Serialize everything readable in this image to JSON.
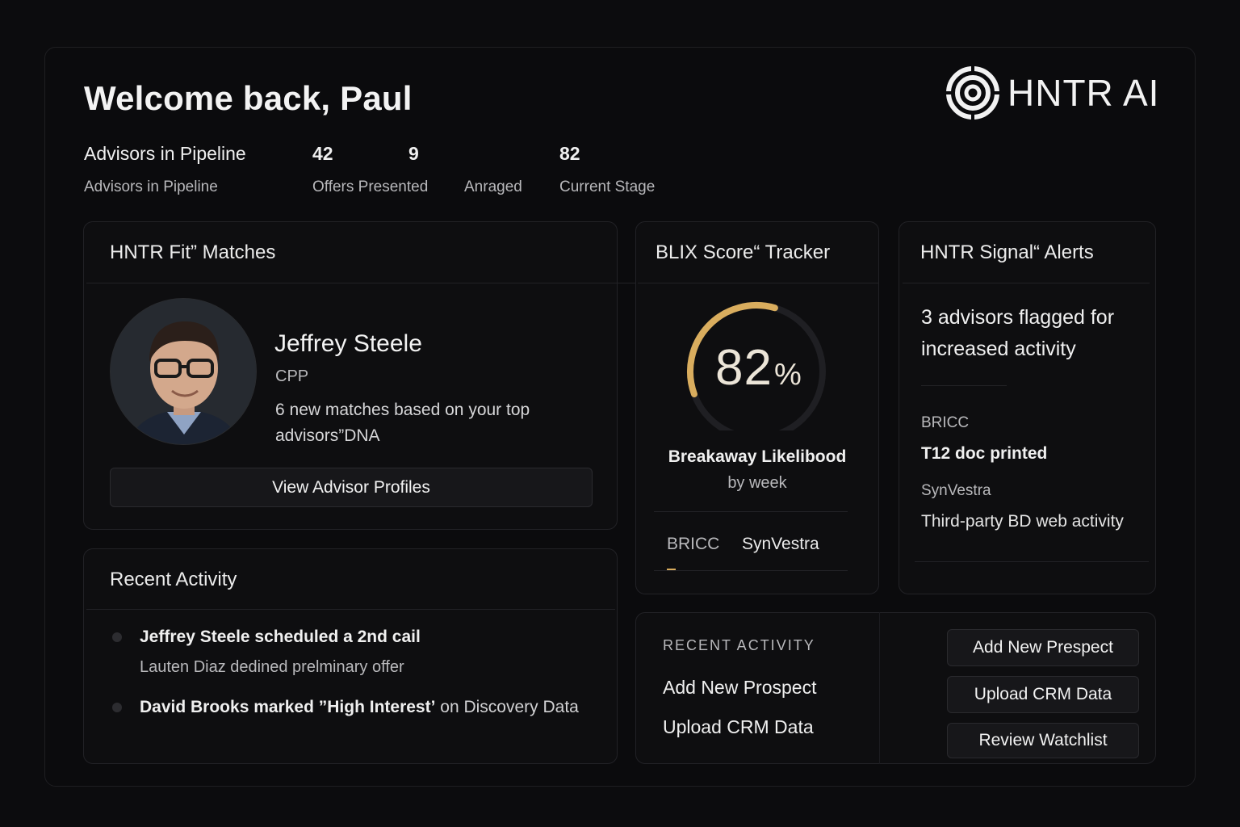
{
  "header": {
    "welcome": "Welcome back, Paul",
    "brand": "HNTR AI"
  },
  "stats": {
    "pipeline_title": "Advisors in Pipeline",
    "pipeline_label": "Advisors in Pipeline",
    "offers_value": "42",
    "offers_label": "Offers Presented",
    "arranged_value": "9",
    "arranged_label": "Anraged",
    "stage_value": "82",
    "stage_label": "Current Stage"
  },
  "fit_matches": {
    "title": "HNTR Fit” Matches",
    "name": "Jeffrey Steele",
    "designation": "CPP",
    "description_line1": "6 new matches based on your top",
    "description_line2": "advisors”DNA",
    "button": "View Advisor Profiles"
  },
  "blix": {
    "title": "BLIX Score“  Tracker",
    "score": "82",
    "score_unit": "%",
    "score_value": 0.82,
    "caption_line1": "Breakaway Likelibood",
    "caption_line2": "by week",
    "tab1": "BRICC",
    "tab2": "SynVestra",
    "accent": "#d9ad5e"
  },
  "signal": {
    "title": "HNTR Signal“ Alerts",
    "headline_line1": "3 advisors flagged for",
    "headline_line2": "increased activity",
    "item1_source": "BRICC",
    "item1_text": "T12 doc printed",
    "item2_source": "SynVestra",
    "item2_text": "Third-party BD web activity"
  },
  "recent_activity": {
    "title": "Recent Activity",
    "item1_main": "Jeffrey Steele scheduled a 2nd cail",
    "item1_sub": "Lauten Diaz dedined prelminary offer",
    "item2_main": "David Brooks marked ”High Interest’",
    "item2_tail": " on Discovery Data"
  },
  "quick": {
    "heading": "RECENT ACTIVITY",
    "link1": "Add New Prospect",
    "link2": "Upload CRM Data",
    "btn1": "Add New Prespect",
    "btn2": "Upload CRM Data",
    "btn3": "Review Watchlist"
  }
}
